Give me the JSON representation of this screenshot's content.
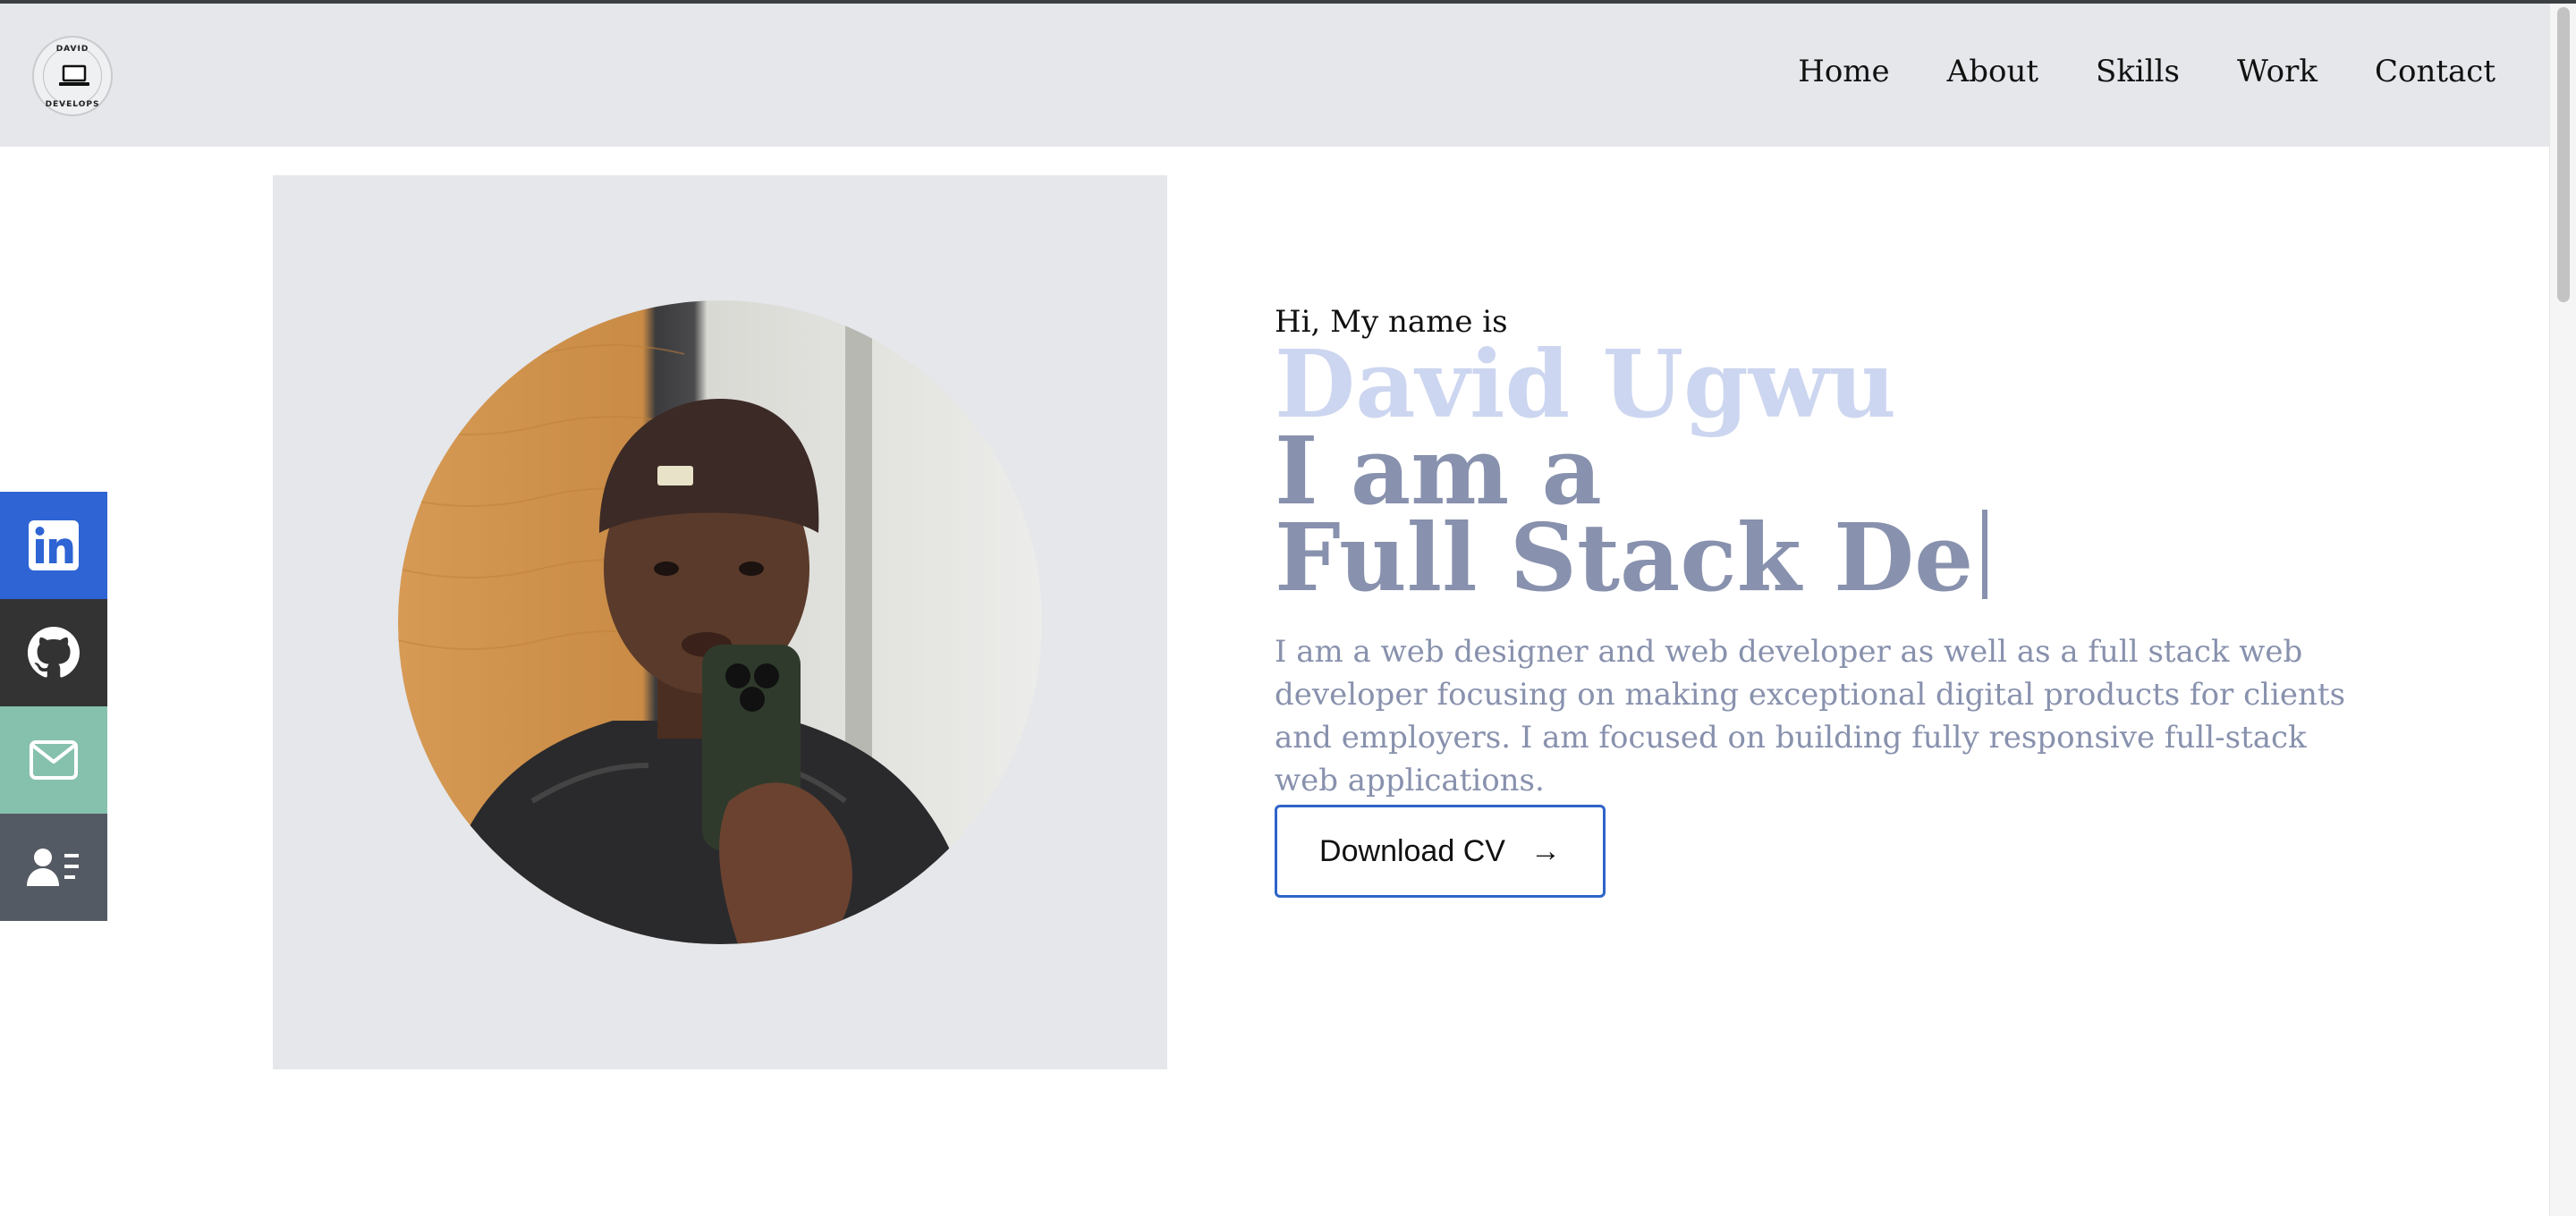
{
  "logo": {
    "top_text": "DAVID",
    "bottom_text": "DEVELOPS"
  },
  "nav": {
    "items": [
      "Home",
      "About",
      "Skills",
      "Work",
      "Contact"
    ]
  },
  "social": [
    {
      "name": "linkedin",
      "icon": "linkedin-icon",
      "color": "#2e64d4"
    },
    {
      "name": "github",
      "icon": "github-icon",
      "color": "#333333"
    },
    {
      "name": "email",
      "icon": "mail-icon",
      "color": "#86c1ad"
    },
    {
      "name": "resume",
      "icon": "contact-card-icon",
      "color": "#545a63"
    }
  ],
  "hero": {
    "greeting": "Hi, My name is",
    "name": "David Ugwu",
    "role_line1": "I am a",
    "role_line2": "Full Stack De",
    "description": "I am a web designer and web developer as well as a full stack web developer focusing on making exceptional digital products for clients and employers. I am focused on building fully responsive full-stack web applications.",
    "cv_button": "Download CV",
    "cv_arrow": "→"
  },
  "colors": {
    "accent_blue": "#2e64c8",
    "name_color": "#cdd6f0",
    "role_color": "#8891ad",
    "header_bg": "#e5e7eb"
  }
}
